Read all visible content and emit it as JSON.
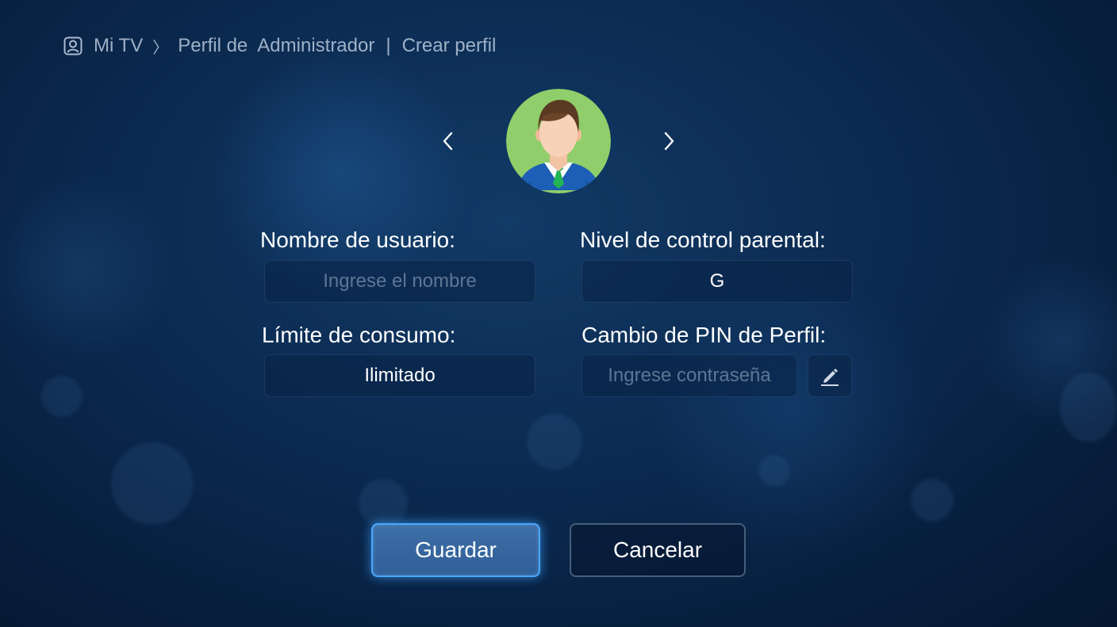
{
  "breadcrumb": {
    "icon": "user-profile-icon",
    "root": "Mi TV",
    "section": "Perfil de  Administrador",
    "separator": "|",
    "current": "Crear perfil"
  },
  "avatar": {
    "prev_icon": "chevron-left-icon",
    "next_icon": "chevron-right-icon",
    "image": "businessman-avatar",
    "background_color": "#8fce6a"
  },
  "form": {
    "username": {
      "label": "Nombre de usuario:",
      "placeholder": "Ingrese el nombre",
      "value": ""
    },
    "parental_control": {
      "label": "Nivel de control parental:",
      "value": "G"
    },
    "consumption_limit": {
      "label": "Límite de consumo:",
      "value": "Ilimitado"
    },
    "profile_pin": {
      "label": "Cambio de PIN de Perfil:",
      "placeholder": "Ingrese contraseña",
      "value": "",
      "edit_icon": "pencil-icon"
    }
  },
  "actions": {
    "save_label": "Guardar",
    "cancel_label": "Cancelar"
  },
  "colors": {
    "background": "#0b2a50",
    "focus_accent": "#4aa8ff",
    "save_button": "#3a6aa3"
  }
}
